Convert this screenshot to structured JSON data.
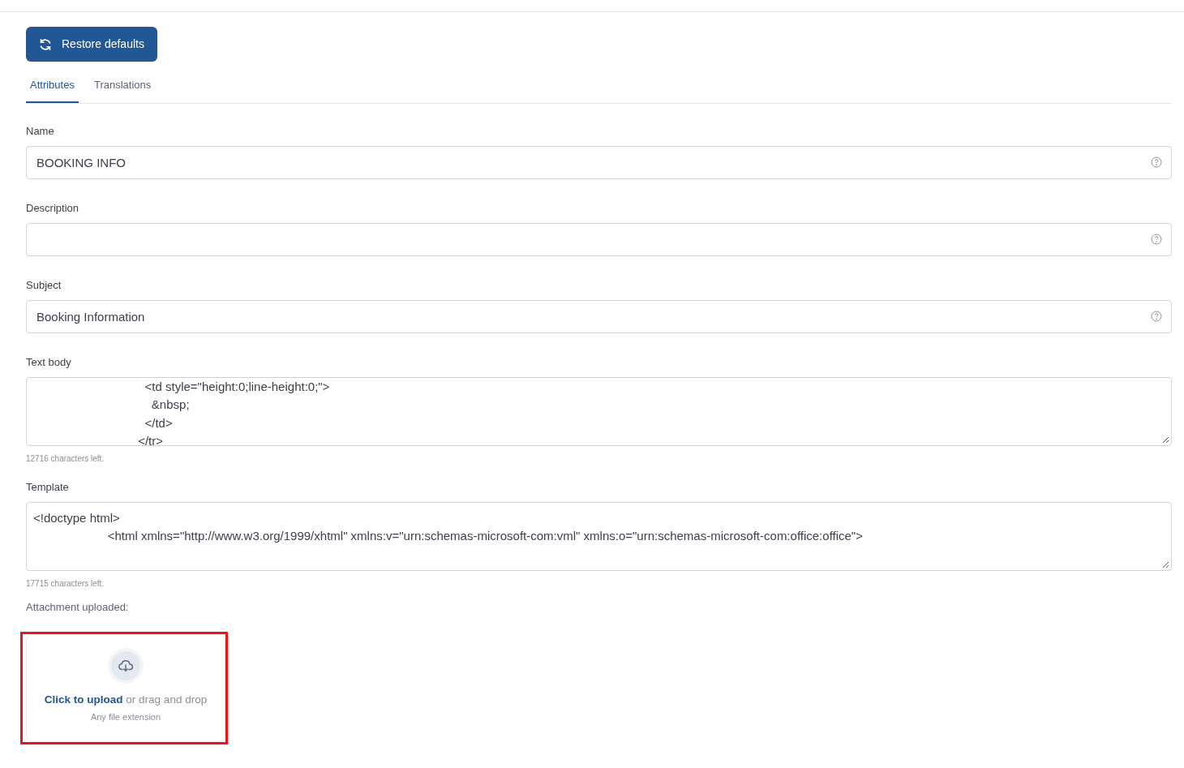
{
  "restore_button": {
    "label": "Restore defaults"
  },
  "tabs": [
    {
      "label": "Attributes",
      "selected": true
    },
    {
      "label": "Translations",
      "selected": false
    }
  ],
  "fields": [
    {
      "label": "Name",
      "value": "BOOKING INFO"
    },
    {
      "label": "Description"
    },
    {
      "label": "Subject",
      "value": "Booking Information"
    }
  ],
  "text_areas": [
    {
      "label": "Text body",
      "lines": [
        "                                 <td style=\"height:0;line-height:0;\">",
        "                                   &nbsp;",
        "                                 </td>",
        "                               </tr>"
      ],
      "counter": "12716 characters left."
    },
    {
      "label": "Template",
      "lines": [
        "<!doctype html>",
        "                      <html xmlns=\"http://www.w3.org/1999/xhtml\" xmlns:v=\"urn:schemas-microsoft-com:vml\" xmlns:o=\"urn:schemas-microsoft-com:office:office\">"
      ],
      "counter": "17715 characters left."
    }
  ],
  "attachment": {
    "label": "Attachment uploaded:",
    "link": "Click to upload",
    "rest": " or drag and drop",
    "hint": "Any file extension",
    "highlighted": true
  }
}
